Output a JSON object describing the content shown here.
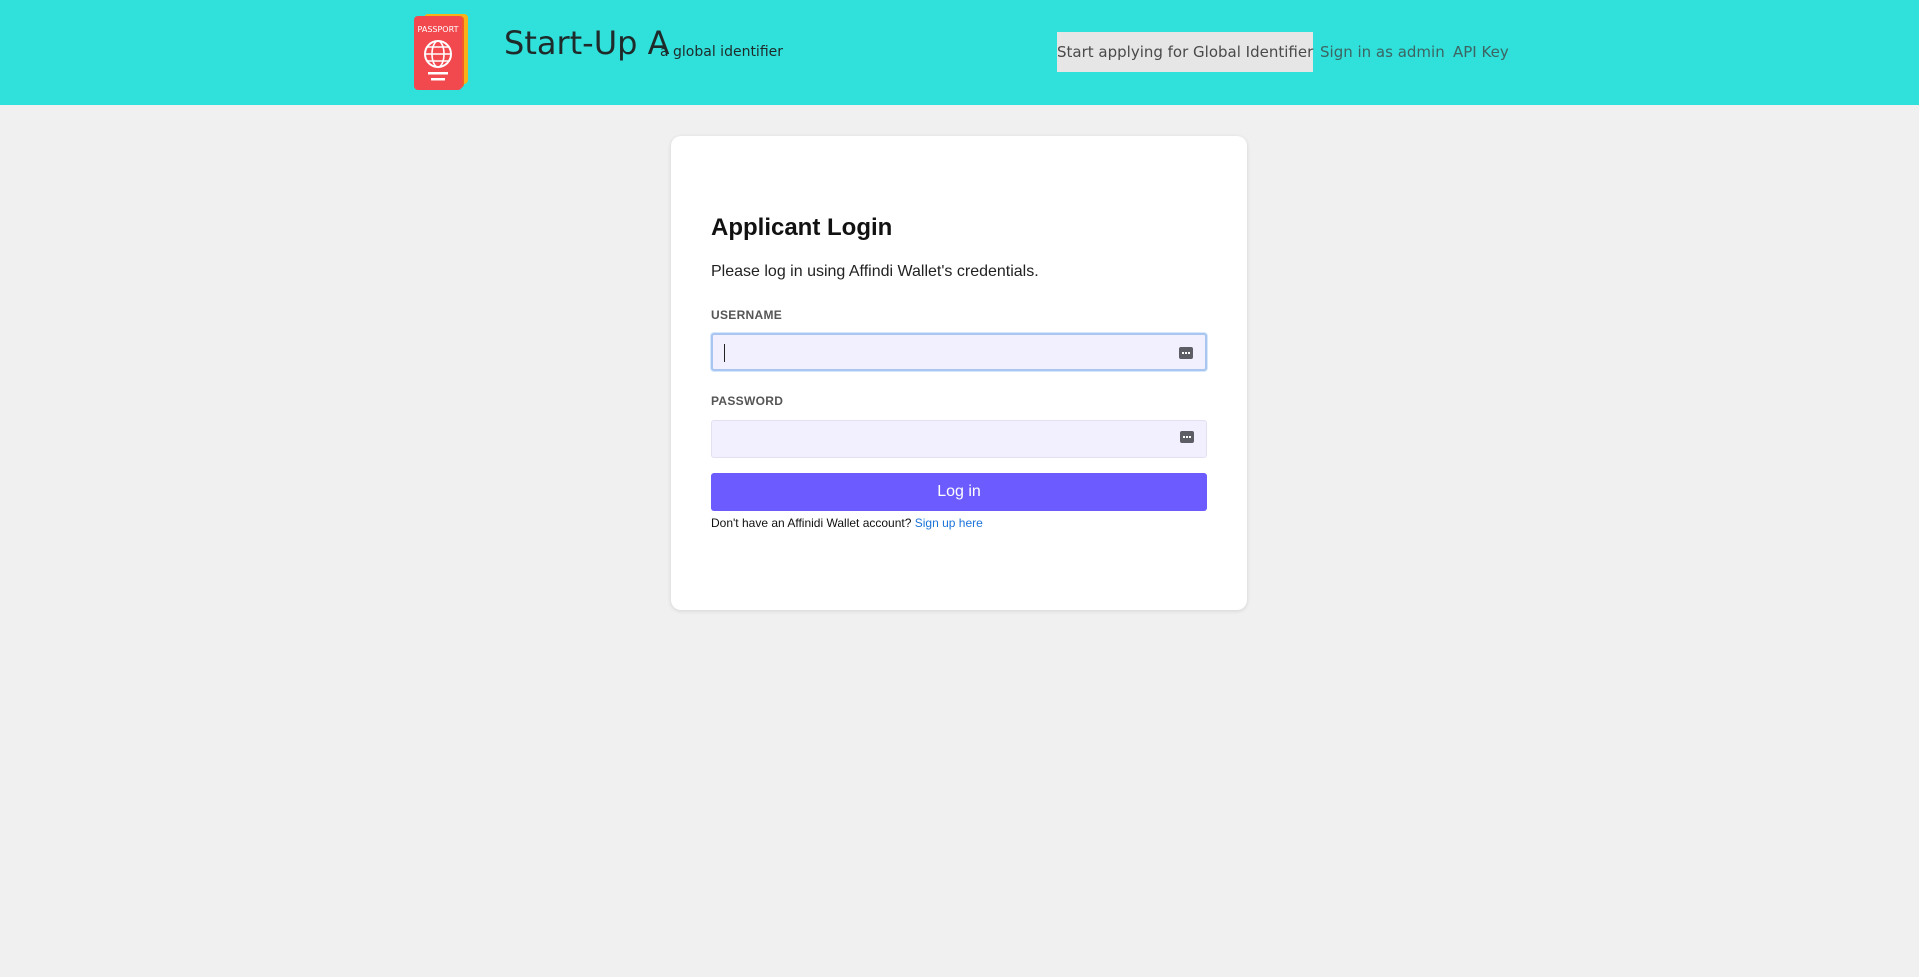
{
  "header": {
    "logo_icon": "passport-icon",
    "logo_text": "PASSPORT",
    "brand_title": "Start-Up A",
    "brand_subtitle": "a global identifier",
    "nav": {
      "apply": "Start applying for Global Identifier",
      "admin": "Sign in as admin",
      "api_key": "API Key"
    },
    "colors": {
      "background": "#30e0da",
      "nav_active_bg": "#e6e6e6"
    }
  },
  "login": {
    "title": "Applicant Login",
    "description": "Please log in using Affindi Wallet's credentials.",
    "username_label": "USERNAME",
    "username_value": "",
    "password_label": "PASSWORD",
    "password_value": "",
    "field_icon": "password-manager-icon",
    "button_label": "Log in",
    "signup_prompt": "Don't have an Affinidi Wallet account?",
    "signup_link": "Sign up here",
    "colors": {
      "button": "#6c5cff",
      "link": "#1a73d9",
      "field_bg": "#f2f0ff"
    }
  }
}
